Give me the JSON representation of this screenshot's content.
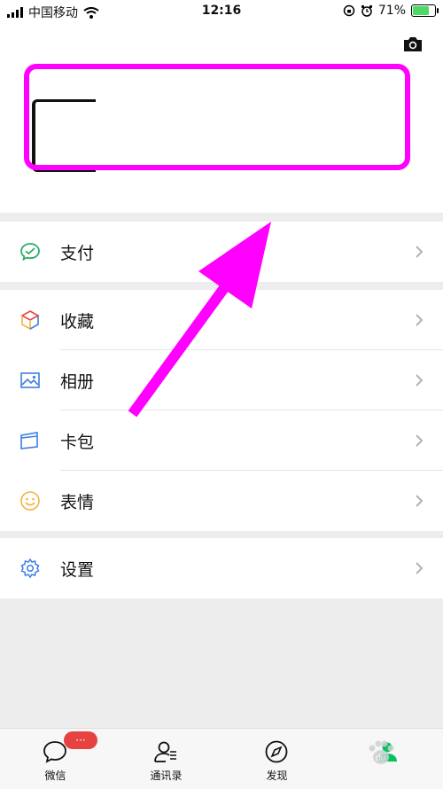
{
  "status_bar": {
    "carrier": "中国移动",
    "time": "12:16",
    "battery": "71%",
    "battery_level": 0.71
  },
  "menu": {
    "pay": "支付",
    "favorites": "收藏",
    "album": "相册",
    "cards": "卡包",
    "stickers": "表情",
    "settings": "设置"
  },
  "tabbar": {
    "chats": "微信",
    "chats_badge": "···",
    "contacts": "通讯录",
    "discover": "发现"
  },
  "colors": {
    "annotation": "#ff00ff",
    "wechat_green": "#07c160",
    "badge": "#e64340"
  }
}
